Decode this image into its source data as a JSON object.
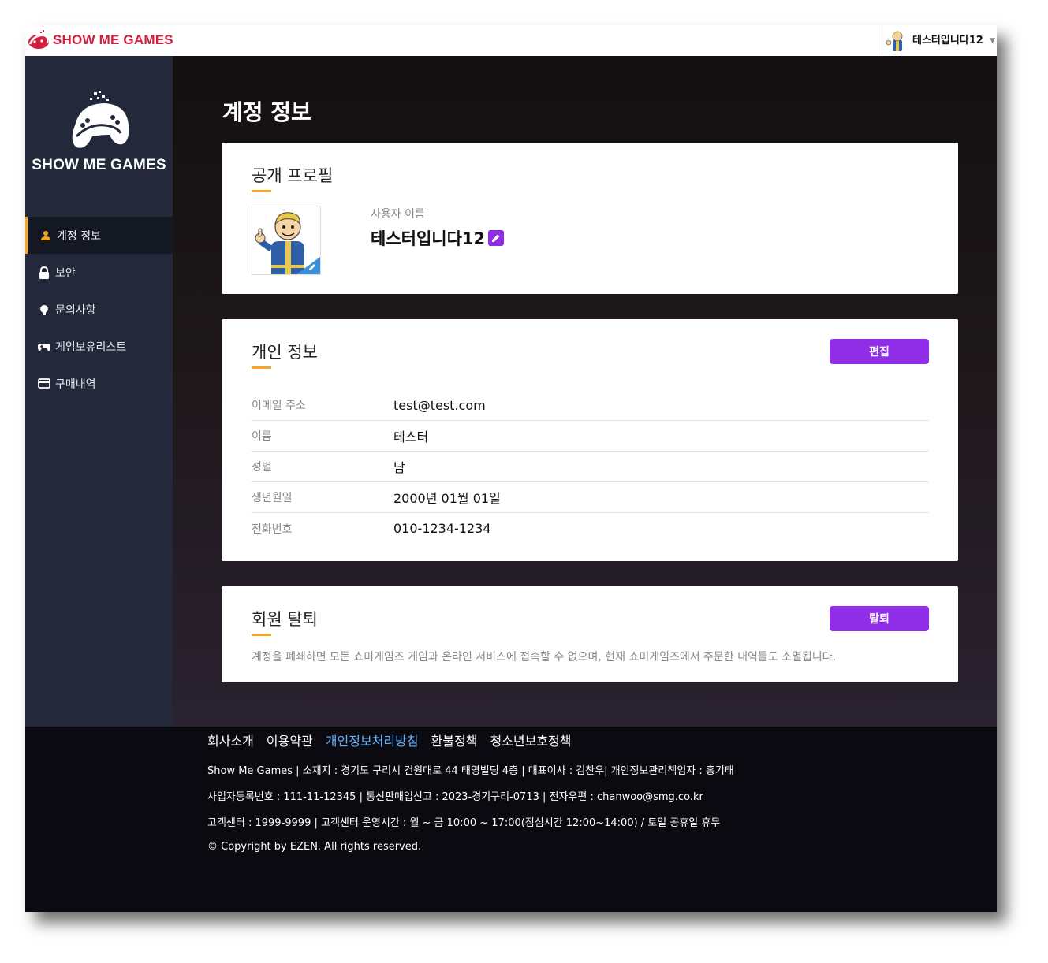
{
  "header": {
    "brand": "SHOW ME GAMES",
    "user_name": "테스터입니다12"
  },
  "sidebar": {
    "logo_text": "SHOW ME GAMES",
    "items": [
      {
        "label": "계정 정보",
        "icon": "user-icon",
        "active": true
      },
      {
        "label": "보안",
        "icon": "lock-icon",
        "active": false
      },
      {
        "label": "문의사항",
        "icon": "headset-icon",
        "active": false
      },
      {
        "label": "게임보유리스트",
        "icon": "gamepad-icon",
        "active": false
      },
      {
        "label": "구매내역",
        "icon": "card-icon",
        "active": false
      }
    ]
  },
  "main": {
    "title": "계정 정보",
    "profile": {
      "title": "공개 프로필",
      "username_label": "사용자 이름",
      "username": "테스터입니다12"
    },
    "personal": {
      "title": "개인 정보",
      "edit_label": "편집",
      "rows": [
        {
          "label": "이메일 주소",
          "value": "test@test.com"
        },
        {
          "label": "이름",
          "value": "테스터"
        },
        {
          "label": "성별",
          "value": "남"
        },
        {
          "label": "생년월일",
          "value": "2000년 01월 01일"
        },
        {
          "label": "전화번호",
          "value": "010-1234-1234"
        }
      ]
    },
    "withdraw": {
      "title": "회원 탈퇴",
      "button_label": "탈퇴",
      "description": "계정을 폐쇄하면 모든 쇼미게임즈 게임과 온라인 서비스에 접속할 수 없으며, 현재 쇼미게임즈에서 주문한 내역들도 소멸됩니다."
    }
  },
  "footer": {
    "links": [
      {
        "label": "회사소개",
        "highlight": false
      },
      {
        "label": "이용약관",
        "highlight": false
      },
      {
        "label": "개인정보처리방침",
        "highlight": true
      },
      {
        "label": "환불정책",
        "highlight": false
      },
      {
        "label": "청소년보호정책",
        "highlight": false
      }
    ],
    "line1": "Show Me Games | 소재지 : 경기도 구리시 건원대로 44 태영빌딩 4층 | 대표이사 : 김찬우| 개인정보관리책임자 : 홍기태",
    "line2": "사업자등록번호 : 111-11-12345 | 통신판매업신고 : 2023-경기구리-0713 | 전자우편 : chanwoo@smg.co.kr",
    "line3": "고객센터 : 1999-9999 | 고객센터 운영시간 : 월 ~ 금 10:00 ~ 17:00(점심시간 12:00~14:00) / 토일 공휴일 휴무",
    "line4": "© Copyright by EZEN. All rights reserved."
  },
  "colors": {
    "accent": "#8f2ee6",
    "underline": "#f5a623",
    "sidebar_bg": "#23293a",
    "brand_red": "#d21e3c",
    "footer_link_highlight": "#62b3ff"
  }
}
